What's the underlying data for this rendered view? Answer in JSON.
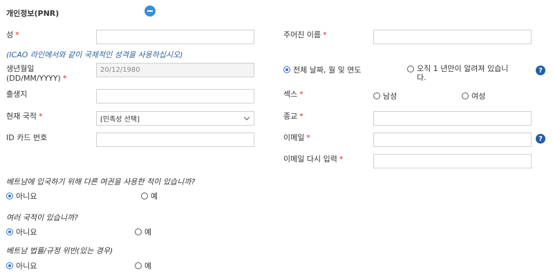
{
  "section": {
    "title": "개인정보(PNR)"
  },
  "fields": {
    "surname_label": "성",
    "given_name_label": "주어진 이름",
    "icao_hint": "(ICAO 라인에서와 같이 국제적인 성격을 사용하십시오)",
    "dob_label_line1": "생년월일",
    "dob_label_line2": "(DD/MM/YYYY)",
    "dob_value": "20/12/1980",
    "dob_full_option": "전체 날짜, 월 및 연도",
    "dob_year_only_line1": "오직 1 년만이 알려져 있습니",
    "dob_year_only_line2": "다.",
    "birthplace_label": "출생지",
    "sex_label": "섹스",
    "sex_male": "남성",
    "sex_female": "여성",
    "nationality_label": "현재 국적",
    "nationality_placeholder": "[민족성 선택]",
    "religion_label": "종교",
    "id_card_label": "ID 카드 번호",
    "email_label": "이메일",
    "email_repeat_label": "이메일 다시 입력",
    "required_mark": "*",
    "help_glyph": "?"
  },
  "questions": {
    "q1": "베트남에 입국하기 위해 다른 여권을 사용한 적이 있습니까?",
    "q2": "여러 국적이 있습니까?",
    "q3": "베트남 법률/규정 위반(있는 경우)",
    "no": "아니요",
    "yes": "예"
  },
  "colors": {
    "accent": "#2a6fc4",
    "required": "#d9232a",
    "hint": "#2a5d9f",
    "help": "#1f5ea8"
  },
  "icons": {
    "collapse": "minus-circle-icon",
    "help": "question-circle-icon",
    "dropdown": "chevron-down-icon"
  }
}
